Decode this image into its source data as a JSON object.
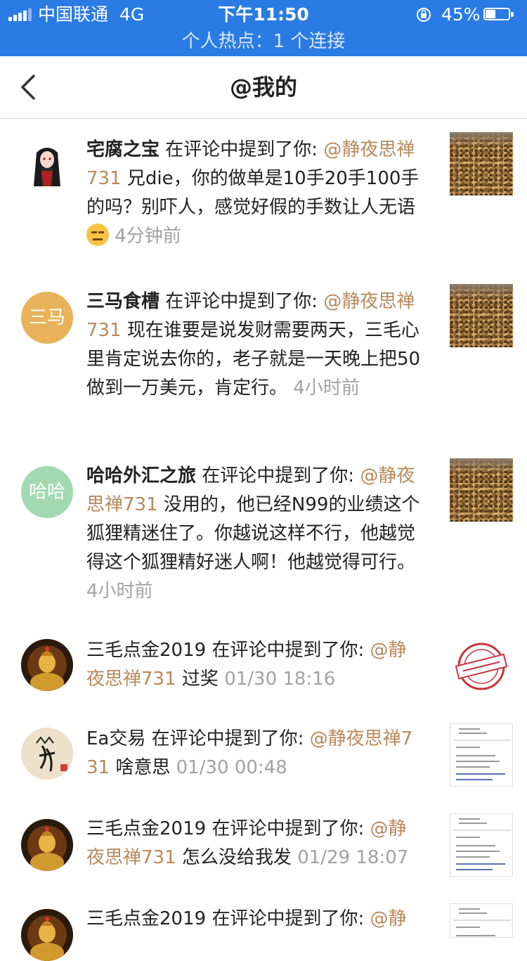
{
  "status_bar": {
    "carrier": "中国联通",
    "network": "4G",
    "time": "下午11:50",
    "battery_percent": "45%",
    "battery_level": 0.45,
    "hotspot": "个人热点：1 个连接"
  },
  "nav": {
    "back_icon": "chevron-left-icon",
    "title": "@我的"
  },
  "notifications": [
    {
      "user": "宅腐之宝",
      "action": "在评论中提到了你:",
      "mention": "@静夜思禅731",
      "text": "兄die，你的做单是10手20手100手的吗？别吓人，感觉好假的手数让人无语",
      "emoji": "expressionless-face-emoji",
      "time": "4分钟前",
      "avatar_text": "",
      "thumb": "grain"
    },
    {
      "user": "三马食槽",
      "action": "在评论中提到了你:",
      "mention": "@静夜思禅731",
      "text": "现在谁要是说发财需要两天，三毛心里肯定说去你的，老子就是一天晚上把50做到一万美元，肯定行。",
      "time": "4小时前",
      "avatar_text": "三马",
      "avatar_color": "#e8b35a",
      "thumb": "grain"
    },
    {
      "user": "哈哈外汇之旅",
      "action": "在评论中提到了你:",
      "mention": "@静夜思禅731",
      "text": "没用的，他已经N99的业绩这个狐狸精迷住了。你越说这样不行，他越觉得这个狐狸精好迷人啊！他越觉得可行。",
      "time": "4小时前",
      "avatar_text": "哈哈",
      "avatar_color": "#a3d9b1",
      "thumb": "grain"
    },
    {
      "user": "三毛点金2019",
      "action": "在评论中提到了你:",
      "mention": "@静夜思禅731",
      "text": "过奖",
      "time": "01/30 18:16",
      "avatar_text": "",
      "thumb": "stamp"
    },
    {
      "user": "Ea交易",
      "action": "在评论中提到了你:",
      "mention": "@静夜思禅731",
      "text": "啥意思",
      "time": "01/30 00:48",
      "avatar_text": "",
      "thumb": "doc"
    },
    {
      "user": "三毛点金2019",
      "action": "在评论中提到了你:",
      "mention": "@静夜思禅731",
      "text": "怎么没给我发",
      "time": "01/29 18:07",
      "avatar_text": "",
      "thumb": "doc"
    },
    {
      "user": "三毛点金2019",
      "action": "在评论中提到了你:",
      "mention": "@静",
      "text": "",
      "time": "",
      "avatar_text": "",
      "thumb": "doc"
    }
  ]
}
